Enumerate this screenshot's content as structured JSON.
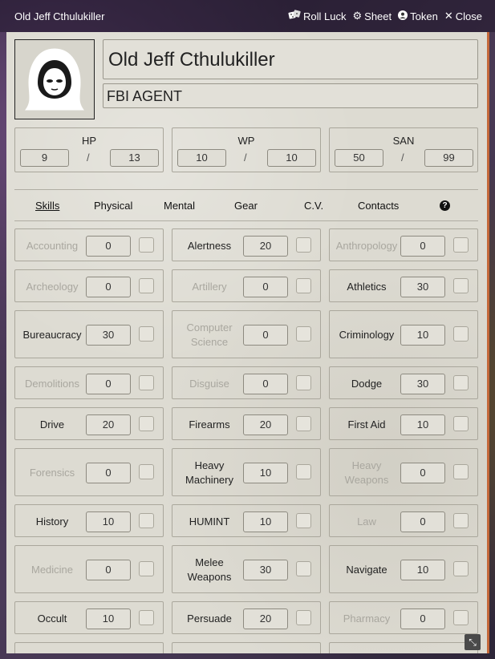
{
  "window": {
    "title": "Old Jeff Cthulukiller",
    "actions": {
      "roll_luck": "Roll Luck",
      "sheet": "Sheet",
      "token": "Token",
      "close": "Close"
    }
  },
  "character": {
    "name": "Old Jeff Cthulukiller",
    "profession": "FBI AGENT"
  },
  "stats": [
    {
      "label": "HP",
      "current": "9",
      "max": "13"
    },
    {
      "label": "WP",
      "current": "10",
      "max": "10"
    },
    {
      "label": "SAN",
      "current": "50",
      "max": "99"
    }
  ],
  "stat_separator": "/",
  "tabs": [
    "Skills",
    "Physical",
    "Mental",
    "Gear",
    "C.V.",
    "Contacts"
  ],
  "help_glyph": "?",
  "skills": [
    {
      "name": "Accounting",
      "value": "0",
      "dim": true
    },
    {
      "name": "Alertness",
      "value": "20",
      "dim": false
    },
    {
      "name": "Anthropology",
      "value": "0",
      "dim": true
    },
    {
      "name": "Archeology",
      "value": "0",
      "dim": true
    },
    {
      "name": "Artillery",
      "value": "0",
      "dim": true
    },
    {
      "name": "Athletics",
      "value": "30",
      "dim": false
    },
    {
      "name": "Bureaucracy",
      "value": "30",
      "dim": false
    },
    {
      "name": "Computer Science",
      "value": "0",
      "dim": true
    },
    {
      "name": "Criminology",
      "value": "10",
      "dim": false
    },
    {
      "name": "Demolitions",
      "value": "0",
      "dim": true
    },
    {
      "name": "Disguise",
      "value": "0",
      "dim": true
    },
    {
      "name": "Dodge",
      "value": "30",
      "dim": false
    },
    {
      "name": "Drive",
      "value": "20",
      "dim": false
    },
    {
      "name": "Firearms",
      "value": "20",
      "dim": false
    },
    {
      "name": "First Aid",
      "value": "10",
      "dim": false
    },
    {
      "name": "Forensics",
      "value": "0",
      "dim": true
    },
    {
      "name": "Heavy Machinery",
      "value": "10",
      "dim": false
    },
    {
      "name": "Heavy Weapons",
      "value": "0",
      "dim": true
    },
    {
      "name": "History",
      "value": "10",
      "dim": false
    },
    {
      "name": "HUMINT",
      "value": "10",
      "dim": false
    },
    {
      "name": "Law",
      "value": "0",
      "dim": true
    },
    {
      "name": "Medicine",
      "value": "0",
      "dim": true
    },
    {
      "name": "Melee Weapons",
      "value": "30",
      "dim": false
    },
    {
      "name": "Navigate",
      "value": "10",
      "dim": false
    },
    {
      "name": "Occult",
      "value": "10",
      "dim": false
    },
    {
      "name": "Persuade",
      "value": "20",
      "dim": false
    },
    {
      "name": "Pharmacy",
      "value": "0",
      "dim": true
    }
  ],
  "colors": {
    "sheet_bg": "#dddbd2",
    "accent": "#c4683a",
    "dim_text": "#a9a79f"
  }
}
